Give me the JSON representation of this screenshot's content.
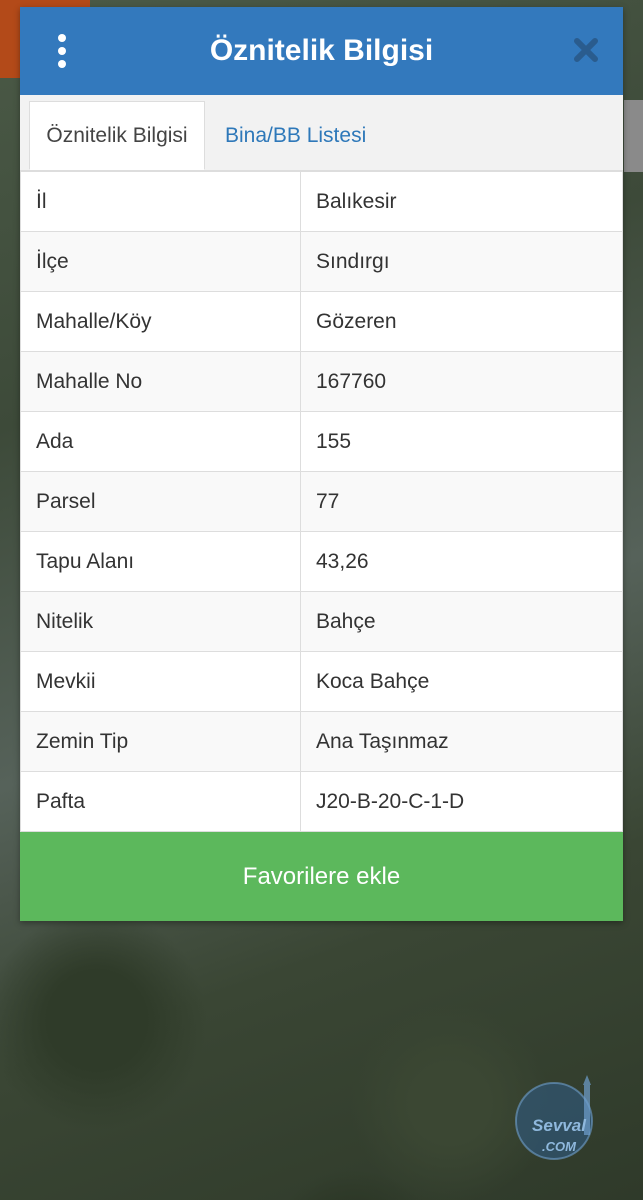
{
  "dialog": {
    "title": "Öznitelik Bilgisi",
    "tabs": [
      {
        "label": "Öznitelik Bilgisi",
        "active": true
      },
      {
        "label": "Bina/BB Listesi",
        "active": false
      }
    ],
    "rows": [
      {
        "key": "İl",
        "value": "Balıkesir"
      },
      {
        "key": "İlçe",
        "value": "Sındırgı"
      },
      {
        "key": "Mahalle/Köy",
        "value": "Gözeren"
      },
      {
        "key": "Mahalle No",
        "value": "167760"
      },
      {
        "key": "Ada",
        "value": "155"
      },
      {
        "key": "Parsel",
        "value": "77"
      },
      {
        "key": "Tapu Alanı",
        "value": "43,26"
      },
      {
        "key": "Nitelik",
        "value": "Bahçe"
      },
      {
        "key": "Mevkii",
        "value": "Koca Bahçe"
      },
      {
        "key": "Zemin Tip",
        "value": "Ana Taşınmaz"
      },
      {
        "key": "Pafta",
        "value": "J20-B-20-C-1-D"
      }
    ],
    "favorite_button_label": "Favorilere ekle"
  },
  "icons": {
    "menu": "more-vertical-icon",
    "close": "close-icon"
  },
  "watermark": {
    "brand": "Sevval",
    "suffix": ".COM"
  },
  "colors": {
    "header": "#3379bd",
    "tab_link": "#2e78b9",
    "button": "#5cb85c"
  }
}
